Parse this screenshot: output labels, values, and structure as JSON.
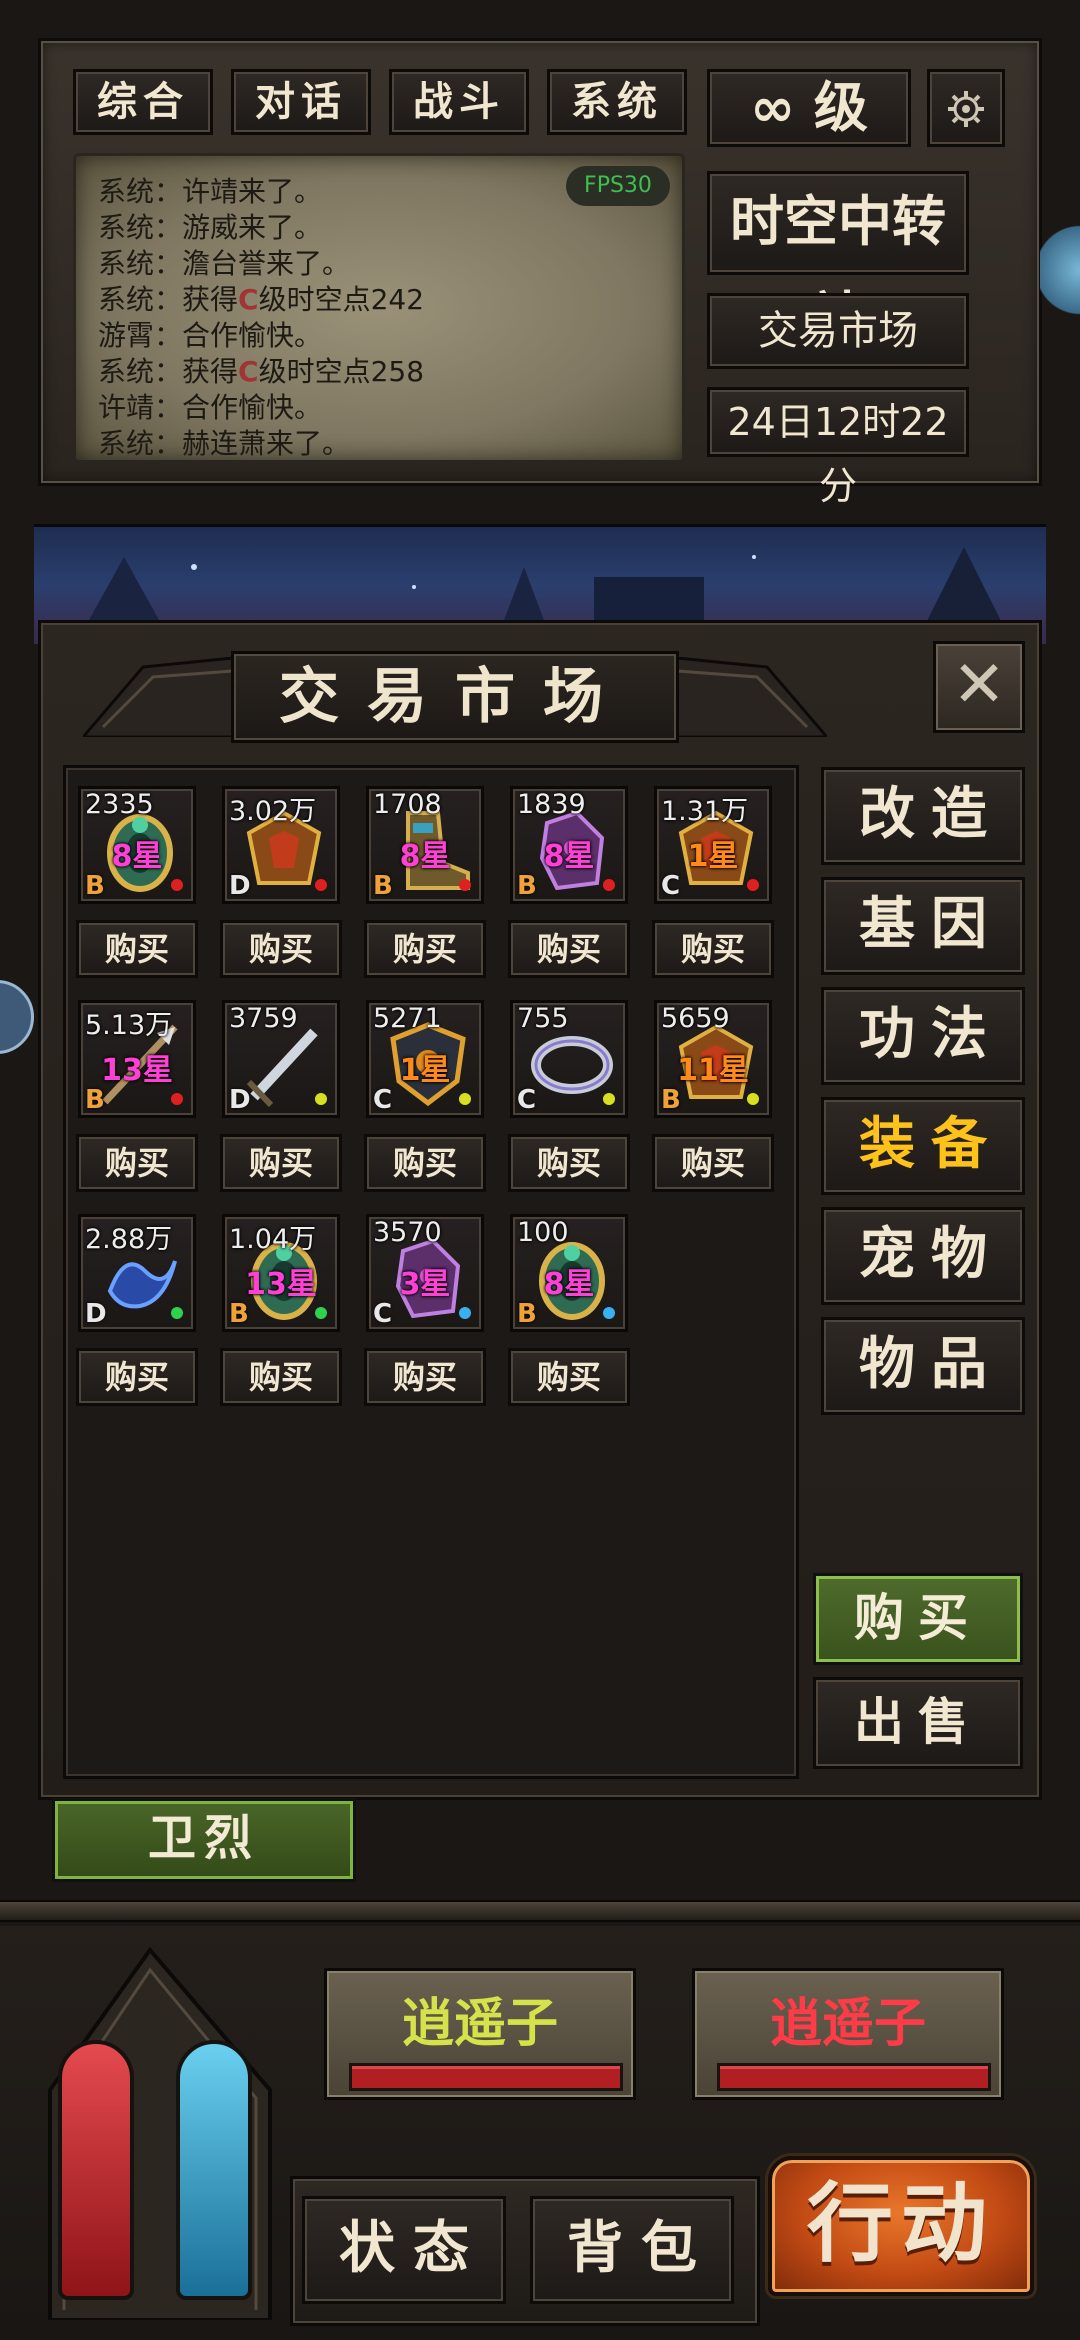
{
  "tabs": [
    "综合",
    "对话",
    "战斗",
    "系统"
  ],
  "level_label": "∞ 级",
  "fps": "FPS30",
  "chat": [
    {
      "speaker": "系统：",
      "pre": "许靖来了。",
      "grade": "",
      "post": ""
    },
    {
      "speaker": "系统：",
      "pre": "游威来了。",
      "grade": "",
      "post": ""
    },
    {
      "speaker": "系统：",
      "pre": "澹台誉来了。",
      "grade": "",
      "post": ""
    },
    {
      "speaker": "系统：",
      "pre": "获得",
      "grade": "C",
      "post": "级时空点242"
    },
    {
      "speaker": "游霄：",
      "pre": "合作愉快。",
      "grade": "",
      "post": ""
    },
    {
      "speaker": "系统：",
      "pre": "获得",
      "grade": "C",
      "post": "级时空点258"
    },
    {
      "speaker": "许靖：",
      "pre": "合作愉快。",
      "grade": "",
      "post": ""
    },
    {
      "speaker": "系统：",
      "pre": "赫连萧来了。",
      "grade": "",
      "post": ""
    }
  ],
  "location": "时空中转站",
  "sub_location": "交易市场",
  "game_time": "24日12时22分",
  "market": {
    "title": "交易市场",
    "buy_button": "购买",
    "items": [
      {
        "price": "2335",
        "stars": "8星",
        "star_color": "#ff3fd6",
        "grade": "B",
        "grade_color": "#f0a23a",
        "dot": "#e02020",
        "icon": "ring-icon"
      },
      {
        "price": "3.02万",
        "stars": "",
        "star_color": "",
        "grade": "D",
        "grade_color": "#e8e8e8",
        "dot": "#e02020",
        "icon": "armor-icon"
      },
      {
        "price": "1708",
        "stars": "8星",
        "star_color": "#ff3fd6",
        "grade": "B",
        "grade_color": "#f0a23a",
        "dot": "#e02020",
        "icon": "boots-icon"
      },
      {
        "price": "1839",
        "stars": "8星",
        "star_color": "#ff3fd6",
        "grade": "B",
        "grade_color": "#f0a23a",
        "dot": "#e02020",
        "icon": "gloves-icon"
      },
      {
        "price": "1.31万",
        "stars": "1星",
        "star_color": "#ff8a1a",
        "grade": "C",
        "grade_color": "#e8e8e8",
        "dot": "#e02020",
        "icon": "armor-icon"
      },
      {
        "price": "5.13万",
        "stars": "13星",
        "star_color": "#ff3fd6",
        "grade": "B",
        "grade_color": "#f0a23a",
        "dot": "#e02020",
        "icon": "spear-icon"
      },
      {
        "price": "3759",
        "stars": "",
        "star_color": "",
        "grade": "D",
        "grade_color": "#e8e8e8",
        "dot": "#d8e020",
        "icon": "sword-icon"
      },
      {
        "price": "5271",
        "stars": "1星",
        "star_color": "#ff8a1a",
        "grade": "C",
        "grade_color": "#e8e8e8",
        "dot": "#d8e020",
        "icon": "shield-icon"
      },
      {
        "price": "755",
        "stars": "",
        "star_color": "",
        "grade": "C",
        "grade_color": "#e8e8e8",
        "dot": "#d8e020",
        "icon": "bracelet-icon"
      },
      {
        "price": "5659",
        "stars": "11星",
        "star_color": "#ff8a1a",
        "grade": "B",
        "grade_color": "#f0a23a",
        "dot": "#d8e020",
        "icon": "armor-icon"
      },
      {
        "price": "2.88万",
        "stars": "",
        "star_color": "",
        "grade": "D",
        "grade_color": "#e8e8e8",
        "dot": "#30d050",
        "icon": "spirit-icon"
      },
      {
        "price": "1.04万",
        "stars": "13星",
        "star_color": "#ff3fd6",
        "grade": "B",
        "grade_color": "#f0a23a",
        "dot": "#30d050",
        "icon": "ring-icon"
      },
      {
        "price": "3570",
        "stars": "3星",
        "star_color": "#ff3fd6",
        "grade": "C",
        "grade_color": "#e8e8e8",
        "dot": "#3ab0f0",
        "icon": "gloves-icon"
      },
      {
        "price": "100",
        "stars": "8星",
        "star_color": "#ff3fd6",
        "grade": "B",
        "grade_color": "#f0a23a",
        "dot": "#3ab0f0",
        "icon": "ring-icon"
      }
    ],
    "categories": [
      {
        "label": "改造",
        "active": false
      },
      {
        "label": "基因",
        "active": false
      },
      {
        "label": "功法",
        "active": false
      },
      {
        "label": "装备",
        "active": true
      },
      {
        "label": "宠物",
        "active": false
      },
      {
        "label": "物品",
        "active": false
      }
    ],
    "buy_big": "购买",
    "sell_big": "出售"
  },
  "npc_name": "卫烈",
  "targets": [
    {
      "name": "逍遥子",
      "color": "#d6e24a",
      "hp": 1.0
    },
    {
      "name": "逍遥子",
      "color": "#ff3b47",
      "hp": 1.0
    }
  ],
  "status_button": "状态",
  "bag_button": "背包",
  "action_button": "行动",
  "colors": {
    "active_category": "#ffc21a",
    "hp_vial": "#c8262b",
    "mp_vial": "#2fa7d6"
  }
}
